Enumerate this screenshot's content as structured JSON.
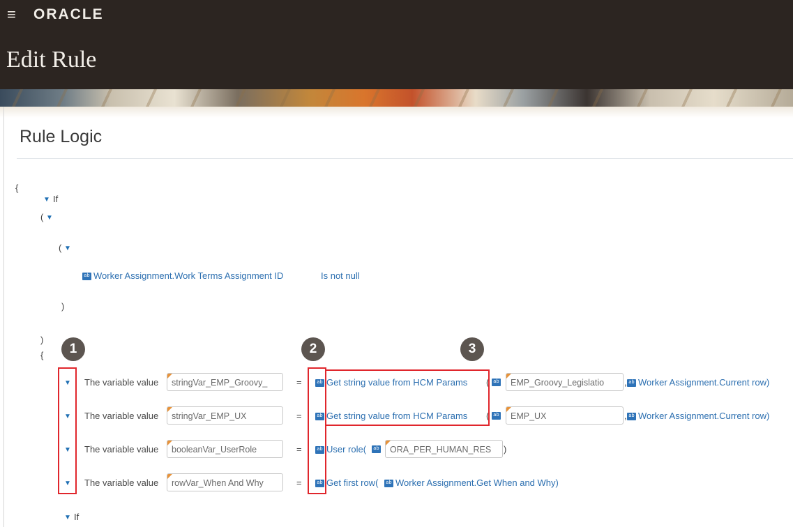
{
  "header": {
    "menu_icon": "hamburger-menu-icon",
    "brand": "ORACLE",
    "page_title": "Edit Rule"
  },
  "section": {
    "title": "Rule Logic"
  },
  "logic": {
    "open_brace": "{",
    "if_keyword": "If",
    "open_paren": "(",
    "close_paren": ")",
    "condition": {
      "field": "Worker Assignment.Work Terms Assignment ID",
      "operator": "Is not null"
    },
    "then_brace": "{",
    "if_keyword_2": "If"
  },
  "assignments": {
    "label": "The variable value",
    "equals": "=",
    "rows": [
      {
        "variable": "stringVar_EMP_Groovy_",
        "function": "Get string value from HCM Params",
        "open": "(",
        "param": "EMP_Groovy_Legislatio",
        "separator": ",",
        "context": "Worker Assignment.Current row)"
      },
      {
        "variable": "stringVar_EMP_UX",
        "function": "Get string value from HCM Params",
        "open": "(",
        "param": "EMP_UX",
        "separator": ",",
        "context": "Worker Assignment.Current row)"
      },
      {
        "variable": "booleanVar_UserRole",
        "function": "User role(",
        "param": "ORA_PER_HUMAN_RES",
        "close": ")"
      },
      {
        "variable": "rowVar_When And Why",
        "function": "Get first row(",
        "context": "Worker Assignment.Get When and Why)"
      }
    ]
  },
  "markers": [
    "1",
    "2",
    "3"
  ],
  "colors": {
    "header_bg": "#2c2521",
    "link": "#2c6fb0",
    "highlight": "#e0262c",
    "marker": "#5c5550"
  },
  "icons": {
    "expand": "caret-down-icon",
    "type_badge": "variable-badge-icon"
  }
}
